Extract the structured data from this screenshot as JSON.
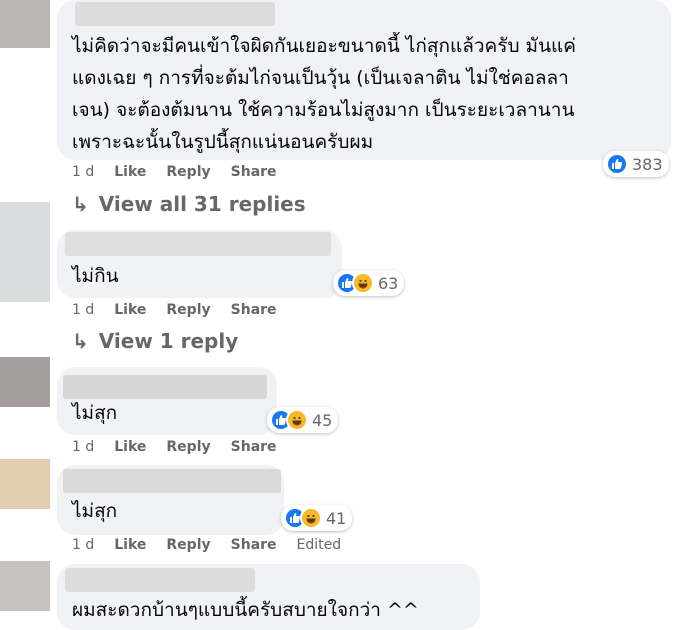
{
  "colors": {
    "bubble": "#f0f2f5",
    "meta_text": "#65676b",
    "like_blue": "#1877f2",
    "haha_yellow": "#f7b928"
  },
  "comments": [
    {
      "text_lines": [
        "ไม่คิดว่าจะมีคนเข้าใจผิดกันเยอะขนาดนี้ ไก่สุกแล้วครับ มันแค่",
        "แดงเฉย ๆ การที่จะต้มไก่จนเป็นวุ้น (เป็นเจลาติน ไม่ใช่คอลลา",
        "เจน) จะต้องต้มนาน ใช้ความร้อนไม่สูงมาก เป็นระยะเวลานาน",
        "เพราะฉะนั้นในรูปนี้สุกแน่นอนครับผม"
      ],
      "age": "1 d",
      "like": "Like",
      "reply": "Reply",
      "share": "Share",
      "reactions": [
        "like-icon"
      ],
      "reaction_count": "383"
    },
    {
      "text_lines": [
        "ไม่กิน"
      ],
      "age": "1 d",
      "like": "Like",
      "reply": "Reply",
      "share": "Share",
      "reactions": [
        "like-icon",
        "haha-icon"
      ],
      "reaction_count": "63"
    },
    {
      "text_lines": [
        "ไม่สุก"
      ],
      "age": "1 d",
      "like": "Like",
      "reply": "Reply",
      "share": "Share",
      "reactions": [
        "like-icon",
        "haha-icon"
      ],
      "reaction_count": "45"
    },
    {
      "text_lines": [
        "ไม่สุก"
      ],
      "age": "1 d",
      "like": "Like",
      "reply": "Reply",
      "share": "Share",
      "edited": "Edited",
      "reactions": [
        "like-icon",
        "haha-icon"
      ],
      "reaction_count": "41"
    },
    {
      "text_lines": [
        "ผมสะดวกบ้านๆแบบนี้ครับสบายใจกว่า ^^"
      ]
    }
  ],
  "view_replies": [
    {
      "arrow": "↳",
      "label": "View all 31 replies"
    },
    {
      "arrow": "↳",
      "label": "View 1 reply"
    }
  ]
}
